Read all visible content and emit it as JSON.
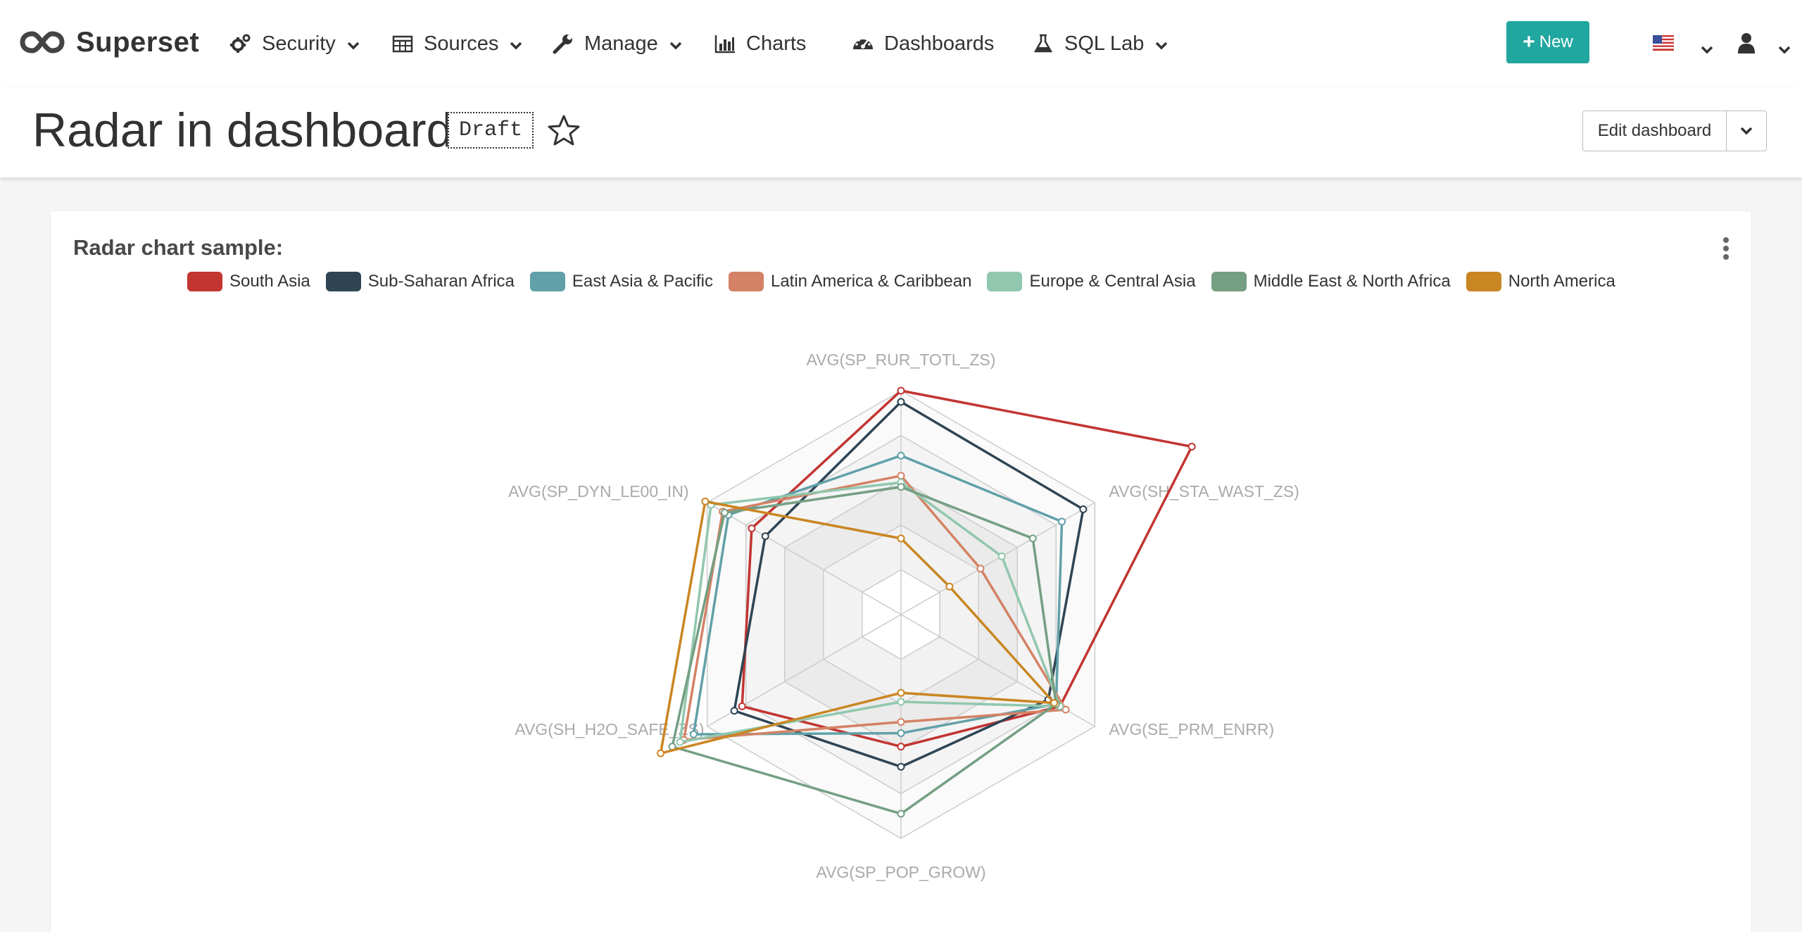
{
  "navbar": {
    "brand": "Superset",
    "items": [
      {
        "label": "Security",
        "icon": "cogs-icon"
      },
      {
        "label": "Sources",
        "icon": "table-icon"
      },
      {
        "label": "Manage",
        "icon": "wrench-icon"
      },
      {
        "label": "Charts",
        "icon": "bar-chart-icon"
      },
      {
        "label": "Dashboards",
        "icon": "dashboard-icon"
      },
      {
        "label": "SQL Lab",
        "icon": "flask-icon"
      }
    ],
    "new_button": "New",
    "language_icon": "us-flag-icon",
    "user_icon": "user-icon",
    "accent_color": "#20a7a0"
  },
  "dashboard": {
    "title": "Radar in dashboard",
    "status_badge": "Draft",
    "edit_button": "Edit dashboard"
  },
  "chart": {
    "title": "Radar chart sample:"
  },
  "chart_data": {
    "type": "radar",
    "indicators": [
      "AVG(SP_RUR_TOTL_ZS)",
      "AVG(SH_STA_WAST_ZS)",
      "AVG(SE_PRM_ENRR)",
      "AVG(SP_POP_GROW)",
      "AVG(SH_H2O_SAFE_ZS)",
      "AVG(SP_DYN_LE00_IN)"
    ],
    "axis_max": 1.0,
    "rings": 5,
    "series": [
      {
        "name": "South Asia",
        "color": "#c23531",
        "values": [
          1.0,
          1.5,
          0.82,
          0.59,
          0.82,
          0.77
        ]
      },
      {
        "name": "Sub-Saharan Africa",
        "color": "#2f4554",
        "values": [
          0.95,
          0.94,
          0.76,
          0.68,
          0.86,
          0.7
        ]
      },
      {
        "name": "East Asia & Pacific",
        "color": "#61a0a8",
        "values": [
          0.71,
          0.83,
          0.8,
          0.53,
          1.07,
          0.89
        ]
      },
      {
        "name": "Latin America & Caribbean",
        "color": "#d48265",
        "values": [
          0.62,
          0.41,
          0.85,
          0.48,
          1.12,
          0.92
        ]
      },
      {
        "name": "Europe & Central Asia",
        "color": "#91c7ae",
        "values": [
          0.59,
          0.52,
          0.82,
          0.39,
          1.14,
          0.98
        ]
      },
      {
        "name": "Middle East & North Africa",
        "color": "#749f83",
        "values": [
          0.57,
          0.68,
          0.8,
          0.89,
          1.18,
          0.91
        ]
      },
      {
        "name": "North America",
        "color": "#ca8622",
        "values": [
          0.34,
          0.25,
          0.79,
          0.35,
          1.24,
          1.01
        ]
      }
    ],
    "legend_position": "top"
  }
}
